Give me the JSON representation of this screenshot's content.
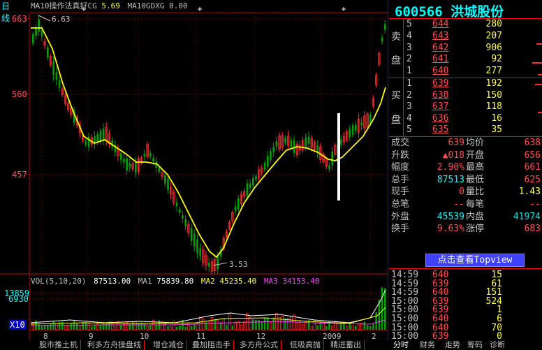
{
  "header": {
    "period": "日线",
    "indicator": "MA10操作法真好CG",
    "cg_value": "5.69",
    "ma10gdxg_label": "MA10GDXG",
    "ma10gdxg_value": "0.00"
  },
  "stock": {
    "code": "600566",
    "name": "洪城股份"
  },
  "price_axis": {
    "ticks": [
      "663",
      "560",
      "457"
    ]
  },
  "vol_axis": {
    "ticks": [
      "13859",
      "6930",
      "X10"
    ]
  },
  "annotations": {
    "high": "6.63",
    "low": "3.53",
    "year": "2009"
  },
  "x_axis_labels": [
    "8",
    "9",
    "10",
    "11",
    "12",
    "2009",
    "2"
  ],
  "volume_header": {
    "label": "VOL(5,10,20)",
    "vol": "87513.00",
    "ma1_label": "MA1",
    "ma1": "75839.80",
    "ma2_label": "MA2",
    "ma2": "45235.40",
    "ma3_label": "MA3",
    "ma3": "34153.40"
  },
  "order_book": {
    "sell_label_1": "卖",
    "sell_label_2": "盘",
    "buy_label_1": "买",
    "buy_label_2": "盘",
    "sell": [
      {
        "level": "5",
        "price": "644",
        "vol": "280"
      },
      {
        "level": "4",
        "price": "643",
        "vol": "207"
      },
      {
        "level": "3",
        "price": "642",
        "vol": "906"
      },
      {
        "level": "2",
        "price": "641",
        "vol": "92"
      },
      {
        "level": "1",
        "price": "640",
        "vol": "277"
      }
    ],
    "buy": [
      {
        "level": "1",
        "price": "639",
        "vol": "192"
      },
      {
        "level": "2",
        "price": "638",
        "vol": "150"
      },
      {
        "level": "3",
        "price": "637",
        "vol": "118"
      },
      {
        "level": "4",
        "price": "636",
        "vol": "16"
      },
      {
        "level": "5",
        "price": "635",
        "vol": "35"
      }
    ]
  },
  "quote": [
    {
      "l1": "成交",
      "v1": "639",
      "l2": "均价",
      "v2": "638"
    },
    {
      "l1": "升跌",
      "v1": "▲018",
      "l2": "开盘",
      "v2": "656"
    },
    {
      "l1": "幅度",
      "v1": "2.90%",
      "l2": "最高",
      "v2": "661"
    },
    {
      "l1": "总手",
      "v1": "87513",
      "l2": "最低",
      "v2": "625"
    },
    {
      "l1": "现手",
      "v1": "0",
      "l2": "量比",
      "v2": "1.43"
    },
    {
      "l1": "总笔",
      "v1": "--",
      "l2": "每笔",
      "v2": "--"
    },
    {
      "l1": "外盘",
      "v1": "45539",
      "l2": "内盘",
      "v2": "41974"
    },
    {
      "l1": "换手",
      "v1": "9.63%",
      "l2": "涨停",
      "v2": "683"
    }
  ],
  "view_button": "点击查看Topview",
  "ticks": [
    {
      "time": "14:59",
      "price": "640",
      "vol": "15"
    },
    {
      "time": "14:59",
      "price": "639",
      "vol": "61"
    },
    {
      "time": "14:59",
      "price": "640",
      "vol": "151"
    },
    {
      "time": "15:00",
      "price": "639",
      "vol": "524"
    },
    {
      "time": "15:00",
      "price": "639",
      "vol": "1"
    },
    {
      "time": "15:00",
      "price": "640",
      "vol": "6"
    },
    {
      "time": "15:00",
      "price": "640",
      "vol": "70"
    },
    {
      "time": "15:00",
      "price": "639",
      "vol": "0"
    }
  ],
  "bottom_tabs": [
    "股市推土机",
    "利多方舟操盘线",
    "增仓减仓",
    "叠加阻击手",
    "多方舟公式",
    "低吸高抛",
    "精进蓄出"
  ],
  "right_tabs": [
    "分时",
    "财务",
    "走势",
    "筹码",
    "诊断"
  ],
  "colors": {
    "up": "#ff4f4f",
    "down": "#00a000",
    "ma": "#ffff00",
    "grid": "#800000",
    "accent": "#00ffff"
  }
}
